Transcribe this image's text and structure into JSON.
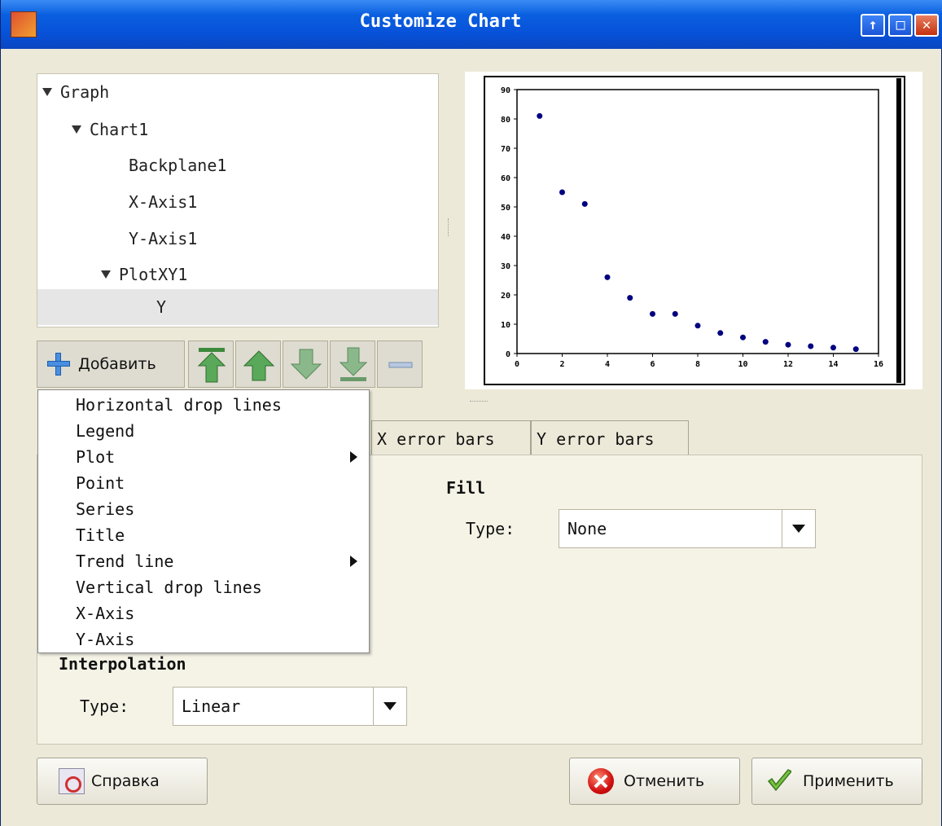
{
  "window": {
    "title": "Customize Chart",
    "buttons": [
      "↑",
      "□",
      "✕"
    ]
  },
  "tree": {
    "items": [
      {
        "label": "Graph",
        "level": 0,
        "expanded": true
      },
      {
        "label": "Chart1",
        "level": 1,
        "expanded": true
      },
      {
        "label": "Backplane1",
        "level": 2
      },
      {
        "label": "X-Axis1",
        "level": 2
      },
      {
        "label": "Y-Axis1",
        "level": 2
      },
      {
        "label": "PlotXY1",
        "level": 2,
        "expanded": true
      },
      {
        "label": "Y",
        "level": 3,
        "selected": true
      }
    ]
  },
  "toolbar": {
    "add_label": "Добавить",
    "buttons": [
      "move-top",
      "move-up",
      "move-down",
      "move-bottom",
      "remove"
    ]
  },
  "add_menu": {
    "items": [
      {
        "label": "Horizontal drop lines"
      },
      {
        "label": "Legend"
      },
      {
        "label": "Plot",
        "submenu": true
      },
      {
        "label": "Point"
      },
      {
        "label": "Series"
      },
      {
        "label": "Title"
      },
      {
        "label": "Trend line",
        "submenu": true
      },
      {
        "label": "Vertical drop lines"
      },
      {
        "label": "X-Axis"
      },
      {
        "label": "Y-Axis"
      }
    ]
  },
  "tabs": [
    "X error bars",
    "Y error bars"
  ],
  "fill": {
    "title": "Fill",
    "type_label": "Type:",
    "type_value": "None"
  },
  "interpolation": {
    "title": "Interpolation",
    "type_label": "Type:",
    "type_value": "Linear"
  },
  "footer": {
    "help_label": "Справка",
    "cancel_label": "Отменить",
    "apply_label": "Применить"
  },
  "chart_data": {
    "type": "scatter",
    "x": [
      1,
      2,
      3,
      4,
      5,
      6,
      7,
      8,
      9,
      10,
      11,
      12,
      13,
      14,
      15
    ],
    "y": [
      81,
      55,
      51,
      26,
      19,
      13.5,
      13.5,
      9.5,
      7,
      5.5,
      4,
      3,
      2.5,
      2,
      1.5
    ],
    "xlim": [
      0,
      16
    ],
    "ylim": [
      0,
      90
    ],
    "xticks": [
      0,
      2,
      4,
      6,
      8,
      10,
      12,
      14,
      16
    ],
    "yticks": [
      0,
      10,
      20,
      30,
      40,
      50,
      60,
      70,
      80,
      90
    ],
    "title": "",
    "xlabel": "",
    "ylabel": "",
    "point_color": "#000080",
    "grid": false
  }
}
